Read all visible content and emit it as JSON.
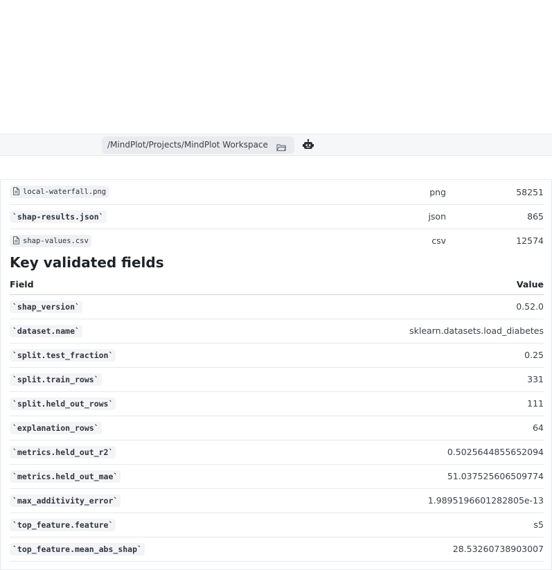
{
  "toolbar": {
    "path": "/MindPlot/Projects/MindPlot Workspace",
    "folder_icon": "folder-open-icon",
    "agent_icon": "robot-icon"
  },
  "files": [
    {
      "name": "local-waterfall.png",
      "style": "file-chip",
      "type": "png",
      "size": "58251"
    },
    {
      "name": "`shap-results.json`",
      "style": "code",
      "type": "json",
      "size": "865"
    },
    {
      "name": "shap-values.csv",
      "style": "file-chip",
      "type": "csv",
      "size": "12574"
    }
  ],
  "fields_section": {
    "title": "Key validated fields",
    "header_field": "Field",
    "header_value": "Value",
    "rows": [
      {
        "field": "`shap_version`",
        "value": "0.52.0"
      },
      {
        "field": "`dataset.name`",
        "value": "sklearn.datasets.load_diabetes"
      },
      {
        "field": "`split.test_fraction`",
        "value": "0.25"
      },
      {
        "field": "`split.train_rows`",
        "value": "331"
      },
      {
        "field": "`split.held_out_rows`",
        "value": "111"
      },
      {
        "field": "`explanation_rows`",
        "value": "64"
      },
      {
        "field": "`metrics.held_out_r2`",
        "value": "0.5025644855652094"
      },
      {
        "field": "`metrics.held_out_mae`",
        "value": "51.037525606509774"
      },
      {
        "field": "`max_additivity_error`",
        "value": "1.9895196601282805e-13"
      },
      {
        "field": "`top_feature.feature`",
        "value": "s5"
      },
      {
        "field": "`top_feature.mean_abs_shap`",
        "value": "28.53260738903007"
      }
    ]
  }
}
